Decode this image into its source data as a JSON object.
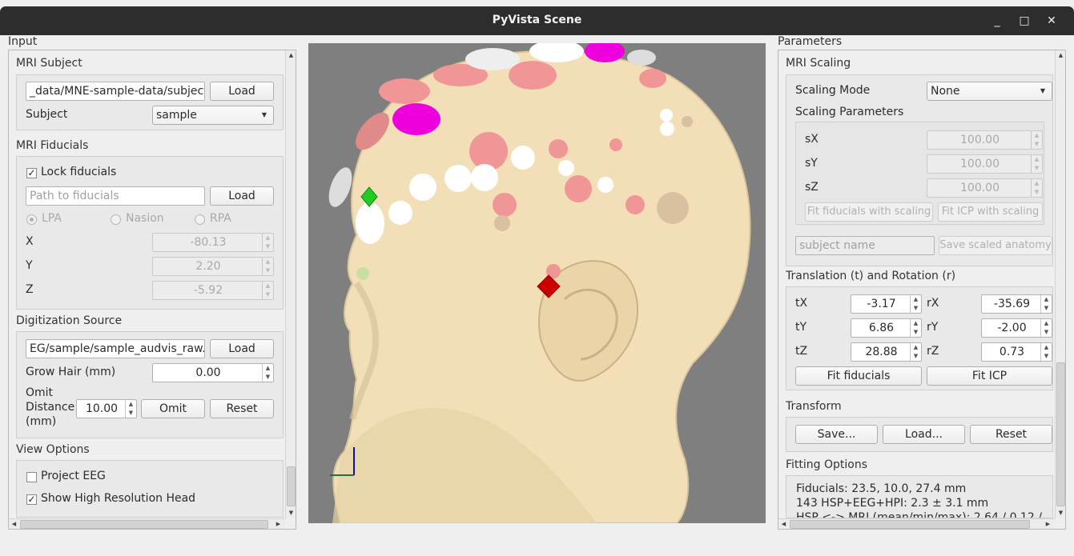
{
  "window": {
    "title": "PyVista Scene",
    "minimize": "_",
    "maximize": "□",
    "close": "✕"
  },
  "left": {
    "title": "Input",
    "mri_subject": {
      "title": "MRI Subject",
      "subjects_dir": "_data/MNE-sample-data/subjects",
      "load_label": "Load",
      "subject_label": "Subject",
      "subject_value": "sample"
    },
    "mri_fiducials": {
      "title": "MRI Fiducials",
      "lock_label": "Lock fiducials",
      "lock_checked": "✓",
      "path_placeholder": "Path to fiducials",
      "load_label": "Load",
      "lpa": "LPA",
      "nasion": "Nasion",
      "rpa": "RPA",
      "x_label": "X",
      "x_value": "-80.13",
      "y_label": "Y",
      "y_value": "2.20",
      "z_label": "Z",
      "z_value": "-5.92"
    },
    "digitization": {
      "title": "Digitization Source",
      "file": "EG/sample/sample_audvis_raw.fif",
      "load_label": "Load",
      "grow_hair_label": "Grow Hair (mm)",
      "grow_hair_value": "0.00",
      "omit_label_1": "Omit",
      "omit_label_2": "Distance",
      "omit_label_3": "(mm)",
      "omit_value": "10.00",
      "omit_button": "Omit",
      "reset_button": "Reset"
    },
    "view_options": {
      "title": "View Options",
      "project_eeg": "Project EEG",
      "show_high_res": "Show High Resolution Head",
      "high_res_checked": "✓"
    }
  },
  "right": {
    "title": "Parameters",
    "mri_scaling": {
      "title": "MRI Scaling",
      "mode_label": "Scaling Mode",
      "mode_value": "None",
      "params_label": "Scaling Parameters",
      "sx_label": "sX",
      "sx_value": "100.00",
      "sy_label": "sY",
      "sy_value": "100.00",
      "sz_label": "sZ",
      "sz_value": "100.00",
      "fit_fid_scaling": "Fit fiducials with scaling",
      "fit_icp_scaling": "Fit ICP with scaling",
      "subject_name_placeholder": "subject name",
      "save_scaled": "Save scaled anatomy"
    },
    "translation": {
      "title": "Translation (t) and Rotation (r)",
      "tx_label": "tX",
      "tx_value": "-3.17",
      "ty_label": "tY",
      "ty_value": "6.86",
      "tz_label": "tZ",
      "tz_value": "28.88",
      "rx_label": "rX",
      "rx_value": "-35.69",
      "ry_label": "rY",
      "ry_value": "-2.00",
      "rz_label": "rZ",
      "rz_value": "0.73",
      "fit_fiducials": "Fit fiducials",
      "fit_icp": "Fit ICP"
    },
    "transform": {
      "title": "Transform",
      "save": "Save...",
      "load": "Load...",
      "reset": "Reset"
    },
    "fitting": {
      "title": "Fitting Options",
      "line1": "Fiducials: 23.5, 10.0, 27.4 mm",
      "line2": "143 HSP+EEG+HPI: 2.3 ± 3.1 mm",
      "line3": "HSP <-> MRI (mean/min/max): 2.64 / 0.12 /"
    }
  },
  "colors": {
    "head": "#f2dfb8",
    "background": "#7f7f7f",
    "electrode_pink": "#f09696",
    "electrode_magenta": "#ee00dd",
    "lpa_marker": "#22cc22",
    "rpa_marker": "#cc0000"
  }
}
